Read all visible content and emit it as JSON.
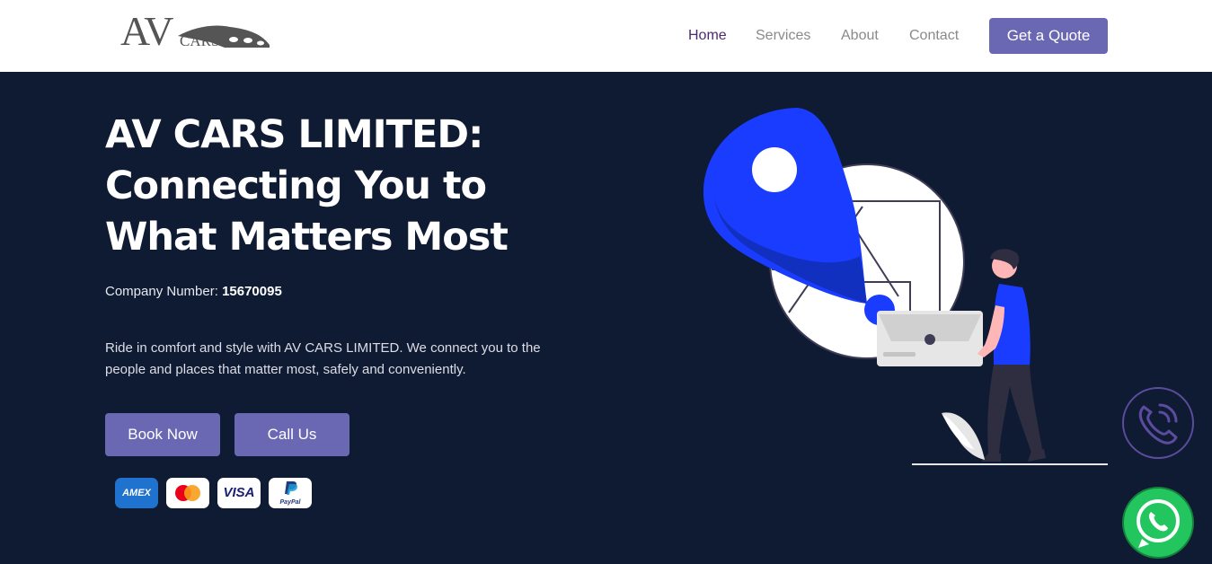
{
  "brand": {
    "logo_main": "AV",
    "logo_sub": "CARS"
  },
  "nav": {
    "items": [
      {
        "label": "Home",
        "active": true
      },
      {
        "label": "Services",
        "active": false
      },
      {
        "label": "About",
        "active": false
      },
      {
        "label": "Contact",
        "active": false
      }
    ],
    "quote_label": "Get a Quote"
  },
  "hero": {
    "title": "AV CARS LIMITED: Connecting You to What Matters Most",
    "company_label": "Company Number:",
    "company_number": "15670095",
    "description": "Ride in comfort and style with AV CARS LIMITED. We connect you to the people and places that matter most, safely and conveniently.",
    "book_label": "Book Now",
    "call_label": "Call Us"
  },
  "payments": {
    "amex": "AMEX",
    "visa": "VISA",
    "paypal": "PayPal"
  },
  "icons": {
    "phone": "phone-call-icon",
    "whatsapp": "whatsapp-icon",
    "map": "map-pin-illustration"
  },
  "colors": {
    "background": "#0f1b33",
    "accent": "#6b68b3",
    "pin_blue": "#1a3cff",
    "whatsapp_green": "#22c55e"
  }
}
